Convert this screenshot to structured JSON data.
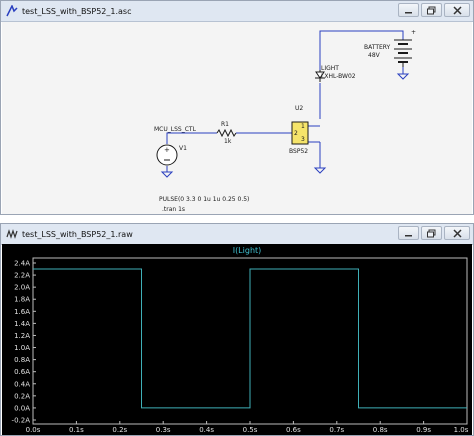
{
  "schematic_window": {
    "title": "test_LSS_with_BSP52_1.asc",
    "labels": {
      "battery_name": "BATTERY",
      "battery_value": "48V",
      "light_name": "LIGHT",
      "light_part": "LXHL-BW02",
      "net_label": "MCU_LSS_CTL",
      "r1_name": "R1",
      "r1_value": "1k",
      "u2_name": "U2",
      "u2_part": "BSP52",
      "u2_pin2": "2",
      "u2_pin1": "1",
      "u2_pin3": "3",
      "v1_name": "V1",
      "pulse_directive": "PULSE(0 3.3 0 1u 1u 0.25 0.5)",
      "tran_directive": ".tran 1s"
    },
    "colors": {
      "wire": "#2a3fbf",
      "component": "#1a1a1a",
      "canvas": "#f4f4f4",
      "ground": "#2a3fbf"
    }
  },
  "waveform_window": {
    "title": "test_LSS_with_BSP52_1.raw",
    "trace_label": "I(Light)",
    "colors": {
      "background": "#000000",
      "trace": "#3fb0b8",
      "axis_text": "#e0e0e0",
      "title_text": "#40c0d0"
    }
  },
  "chart_data": {
    "type": "line",
    "title": "I(Light)",
    "xlabel": "",
    "ylabel": "",
    "x_ticks": [
      "0.0s",
      "0.1s",
      "0.2s",
      "0.3s",
      "0.4s",
      "0.5s",
      "0.6s",
      "0.7s",
      "0.8s",
      "0.9s",
      "1.0s"
    ],
    "y_ticks": [
      "2.4A",
      "2.2A",
      "2.0A",
      "1.8A",
      "1.6A",
      "1.4A",
      "1.2A",
      "1.0A",
      "0.8A",
      "0.6A",
      "0.4A",
      "0.2A",
      "0.0A",
      "-0.2A"
    ],
    "xlim": [
      0,
      1.0
    ],
    "ylim": [
      -0.2,
      2.4
    ],
    "grid": false,
    "series": [
      {
        "name": "I(Light)",
        "x": [
          0,
          0.25,
          0.25,
          0.5,
          0.5,
          0.75,
          0.75,
          1.0
        ],
        "y": [
          2.3,
          2.3,
          0.0,
          0.0,
          2.3,
          2.3,
          0.0,
          0.0
        ]
      }
    ]
  },
  "window_controls": {
    "minimize": "minimize-icon",
    "restore": "restore-icon",
    "close": "close-icon"
  }
}
